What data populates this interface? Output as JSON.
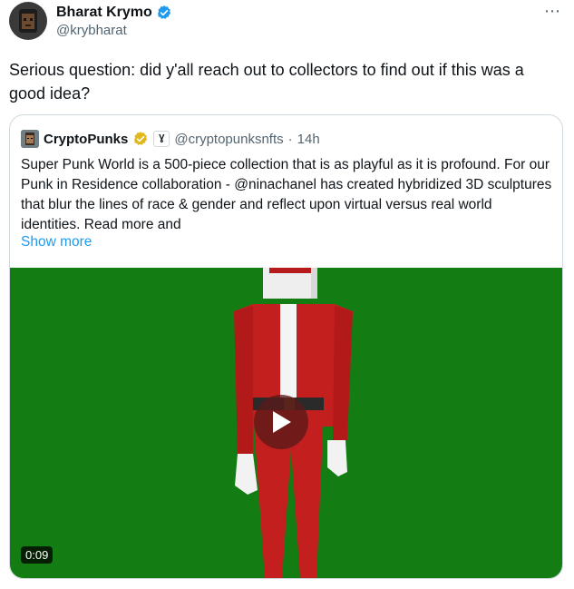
{
  "tweet": {
    "author_name": "Bharat Krymo",
    "author_handle": "@krybharat",
    "more_icon": "⋯",
    "text": "Serious question: did y'all reach out to collectors to find out if this was a good idea?"
  },
  "quote": {
    "author_name": "CryptoPunks",
    "affiliate_badge": "Ɣ",
    "author_handle": "@cryptopunksnfts",
    "separator": "·",
    "time": "14h",
    "text": "Super Punk World is a 500-piece collection that is as playful as it is profound. For our Punk in Residence collaboration - @ninachanel has created hybridized 3D sculptures that blur the lines of race & gender and reflect upon virtual versus real world identities. Read more and",
    "show_more": "Show more",
    "video": {
      "duration": "0:09",
      "background_color": "#137c12",
      "play_icon": "play-icon"
    }
  },
  "colors": {
    "verified_blue": "#1d9bf0",
    "gold_badge": "#e2b719",
    "link": "#1d9bf0",
    "secondary_text": "#536471"
  }
}
